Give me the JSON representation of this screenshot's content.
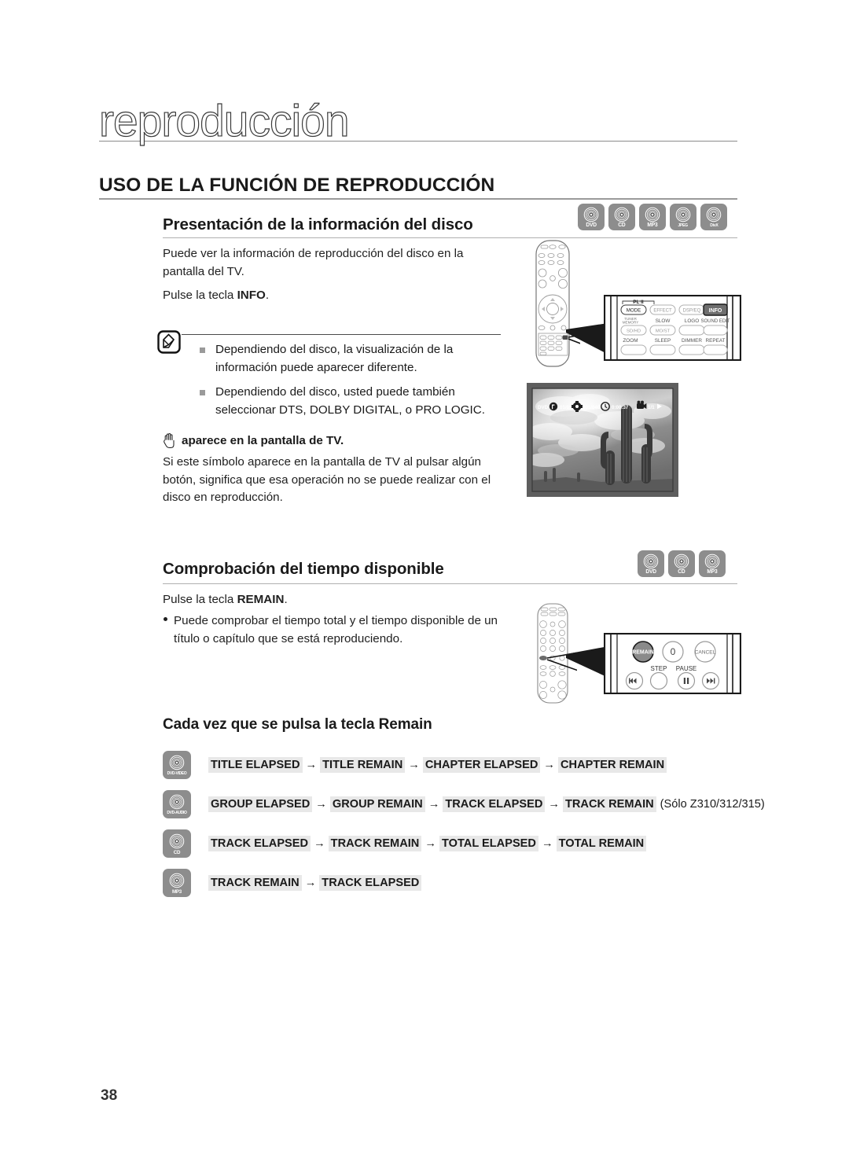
{
  "page": {
    "chapter_title": "reproducción",
    "page_number": "38",
    "h1": "USO DE LA FUNCIÓN DE REPRODUCCIÓN"
  },
  "section_info": {
    "heading": "Presentación de la información del disco",
    "paragraph1": "Puede ver la información de reproducción del disco en la pantalla del TV.",
    "paragraph2_pre": "Pulse la tecla ",
    "paragraph2_bold": "INFO",
    "paragraph2_post": ".",
    "badges": [
      {
        "label": "DVD",
        "icon": "disc-icon"
      },
      {
        "label": "CD",
        "icon": "disc-icon"
      },
      {
        "label": "MP3",
        "icon": "disc-icon"
      },
      {
        "label": "JPEG",
        "icon": "disc-icon"
      },
      {
        "label": "DivX",
        "icon": "disc-icon"
      }
    ],
    "note_icon": "note-pencil-icon",
    "notes": [
      "Dependiendo del disco, la visualización de la información puede aparecer diferente.",
      "Dependiendo del disco, usted puede también seleccionar DTS, DOLBY DIGITAL, o PRO LOGIC."
    ],
    "hand_icon": "hand-stop-icon",
    "hand_heading": "aparece en la pantalla de TV.",
    "hand_paragraph": "Si este símbolo aparece en la pantalla de TV al pulsar algún botón, significa que esa operación no se puede realizar con el disco en reproducción."
  },
  "remote_callout_info": {
    "row1": [
      "MODE",
      "EFFECT",
      "DSP/EQ",
      "INFO"
    ],
    "row1_group_label": "PL II",
    "row2_labels": [
      "TUNER\nMEMORY",
      "SLOW",
      "LOGO",
      "SOUND EDIT"
    ],
    "row2_buttons": [
      "SD/HD",
      "MO/ST",
      "",
      ""
    ],
    "row3_labels": [
      "ZOOM",
      "SLEEP",
      "DIMMER",
      "REPEAT"
    ],
    "highlighted": "INFO"
  },
  "tv_screen": {
    "osd": {
      "disc": "DVD",
      "title_icon": "title-icon",
      "title_value": "01/01",
      "chapter_icon": "chapter-icon",
      "chapter_value": "001/040",
      "time_icon": "clock-icon",
      "time_value": "0:00:37",
      "angle_icon": "camera-icon",
      "angle_value": "1/1",
      "play_icon": "play-icon"
    },
    "image_alt": "cactus-photo"
  },
  "section_remain": {
    "heading": "Comprobación del tiempo disponible",
    "badges": [
      {
        "label": "DVD",
        "icon": "disc-icon"
      },
      {
        "label": "CD",
        "icon": "disc-icon"
      },
      {
        "label": "MP3",
        "icon": "disc-icon"
      }
    ],
    "paragraph1_pre": "Pulse la tecla ",
    "paragraph1_bold": "REMAIN",
    "paragraph1_post": ".",
    "bullet": "Puede comprobar el tiempo total y el tiempo disponible de un título o capítulo que se está reproduciendo."
  },
  "remote_callout_remain": {
    "row1": [
      "REMAIN",
      "0",
      "CANCEL"
    ],
    "row2_labels": [
      "",
      "STEP",
      "PAUSE",
      ""
    ],
    "row2_icons": [
      "prev-icon",
      "step-icon",
      "pause-icon",
      "next-icon"
    ],
    "highlighted": "REMAIN"
  },
  "section_sequence": {
    "heading": "Cada vez que se pulsa la tecla Remain",
    "rows": [
      {
        "badge": "DVD-VIDEO",
        "badge_icon": "disc-icon",
        "steps": [
          "TITLE ELAPSED",
          "TITLE REMAIN",
          "CHAPTER ELAPSED",
          "CHAPTER REMAIN"
        ],
        "suffix": ""
      },
      {
        "badge": "DVD-AUDIO",
        "badge_icon": "disc-icon",
        "steps": [
          "GROUP ELAPSED",
          "GROUP REMAIN",
          "TRACK ELAPSED",
          "TRACK REMAIN"
        ],
        "suffix": "(Sólo Z310/312/315)"
      },
      {
        "badge": "CD",
        "badge_icon": "disc-icon",
        "steps": [
          "TRACK ELAPSED",
          "TRACK REMAIN",
          "TOTAL ELAPSED",
          "TOTAL REMAIN"
        ],
        "suffix": ""
      },
      {
        "badge": "MP3",
        "badge_icon": "disc-icon",
        "steps": [
          "TRACK REMAIN",
          "TRACK ELAPSED"
        ],
        "suffix": ""
      }
    ],
    "arrow_glyph": "→"
  },
  "colors": {
    "badge_gray": "#8d8d8d",
    "chip_gray": "#e8e8e8",
    "rule_gray": "#9a9a9a",
    "highlight_dark": "#7a7a7a"
  }
}
